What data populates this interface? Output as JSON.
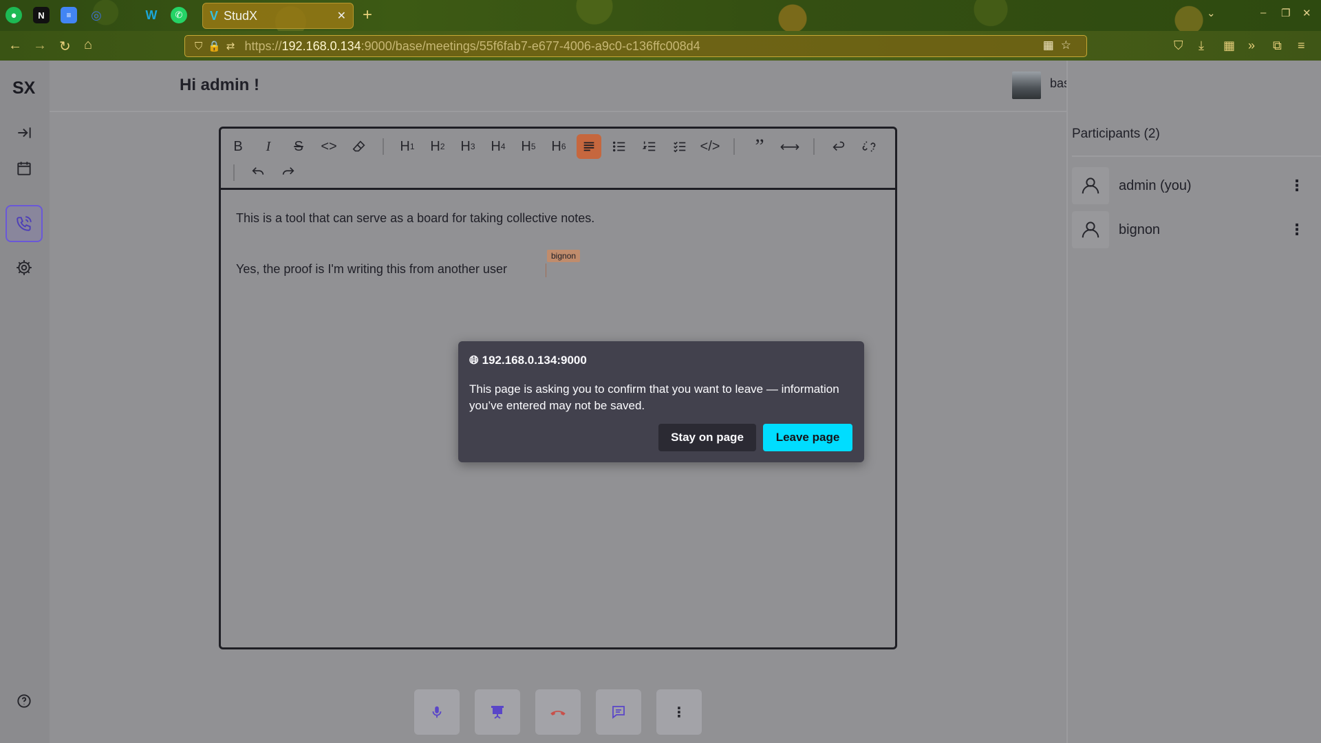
{
  "browser": {
    "tab_title": "StudX",
    "tab_favicon": "V",
    "url_prefix": "https://",
    "url_host": "192.168.0.134",
    "url_rest": ":9000/base/meetings/55f6fab7-e677-4006-a9c0-c136ffc008d4",
    "pinned_tabs": [
      "spotify-icon",
      "notion-icon",
      "docs-icon",
      "chrome-icon",
      "wechat-icon",
      "whatsapp-icon"
    ]
  },
  "app": {
    "logo": "SX",
    "greeting": "Hi admin !",
    "org_name": "base",
    "accent_color": "#6a58d8"
  },
  "editor": {
    "toolbar": {
      "bold": "B",
      "italic": "I",
      "strike": "S",
      "code": "<>",
      "h1": "H",
      "h2": "H",
      "h3": "H",
      "h4": "H",
      "h5": "H",
      "h6": "H",
      "h1_sub": "1",
      "h2_sub": "2",
      "h3_sub": "3",
      "h4_sub": "4",
      "h5_sub": "5",
      "h6_sub": "6",
      "code_block": "</>"
    },
    "paragraph1": "This is a tool that can serve as a board for taking collective notes.",
    "paragraph2": "Yes, the proof is I'm writing this from another user",
    "cursor_user": "bignon"
  },
  "dialog": {
    "host": "192.168.0.134:9000",
    "message": "This page is asking you to confirm that you want to leave — information you’ve entered may not be saved.",
    "stay_label": "Stay on page",
    "leave_label": "Leave page"
  },
  "participants": {
    "title": "Participants (2)",
    "list": [
      {
        "name": "admin (you)"
      },
      {
        "name": "bignon"
      }
    ]
  }
}
